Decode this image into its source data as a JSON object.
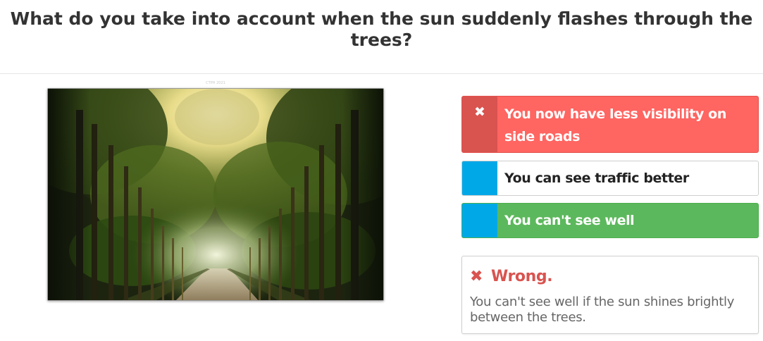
{
  "question": {
    "title": "What do you take into account when the sun suddenly flashes through the trees?"
  },
  "image": {
    "caption": "CTPH 2021",
    "subject": "sunlit tree-lined road"
  },
  "answers": [
    {
      "marker_icon": "close-icon",
      "marker_glyph": "✖",
      "label": "You now have less visibility on side roads",
      "state": "selected-wrong",
      "color": "#ff6561"
    },
    {
      "marker_icon": "",
      "marker_glyph": "",
      "label": "You can see traffic better",
      "state": "neutral",
      "color": "#ffffff"
    },
    {
      "marker_icon": "",
      "marker_glyph": "",
      "label": "You can't see well",
      "state": "correct",
      "color": "#5cb85c"
    }
  ],
  "feedback": {
    "icon": "close-icon",
    "icon_glyph": "✖",
    "title": "Wrong.",
    "body": "You can't see well if the sun shines brightly between the trees.",
    "color": "#d9534f"
  },
  "colors": {
    "wrong": "#d9534f",
    "wrong_light": "#ff6561",
    "correct": "#5cb85c",
    "marker": "#00a8e8"
  }
}
